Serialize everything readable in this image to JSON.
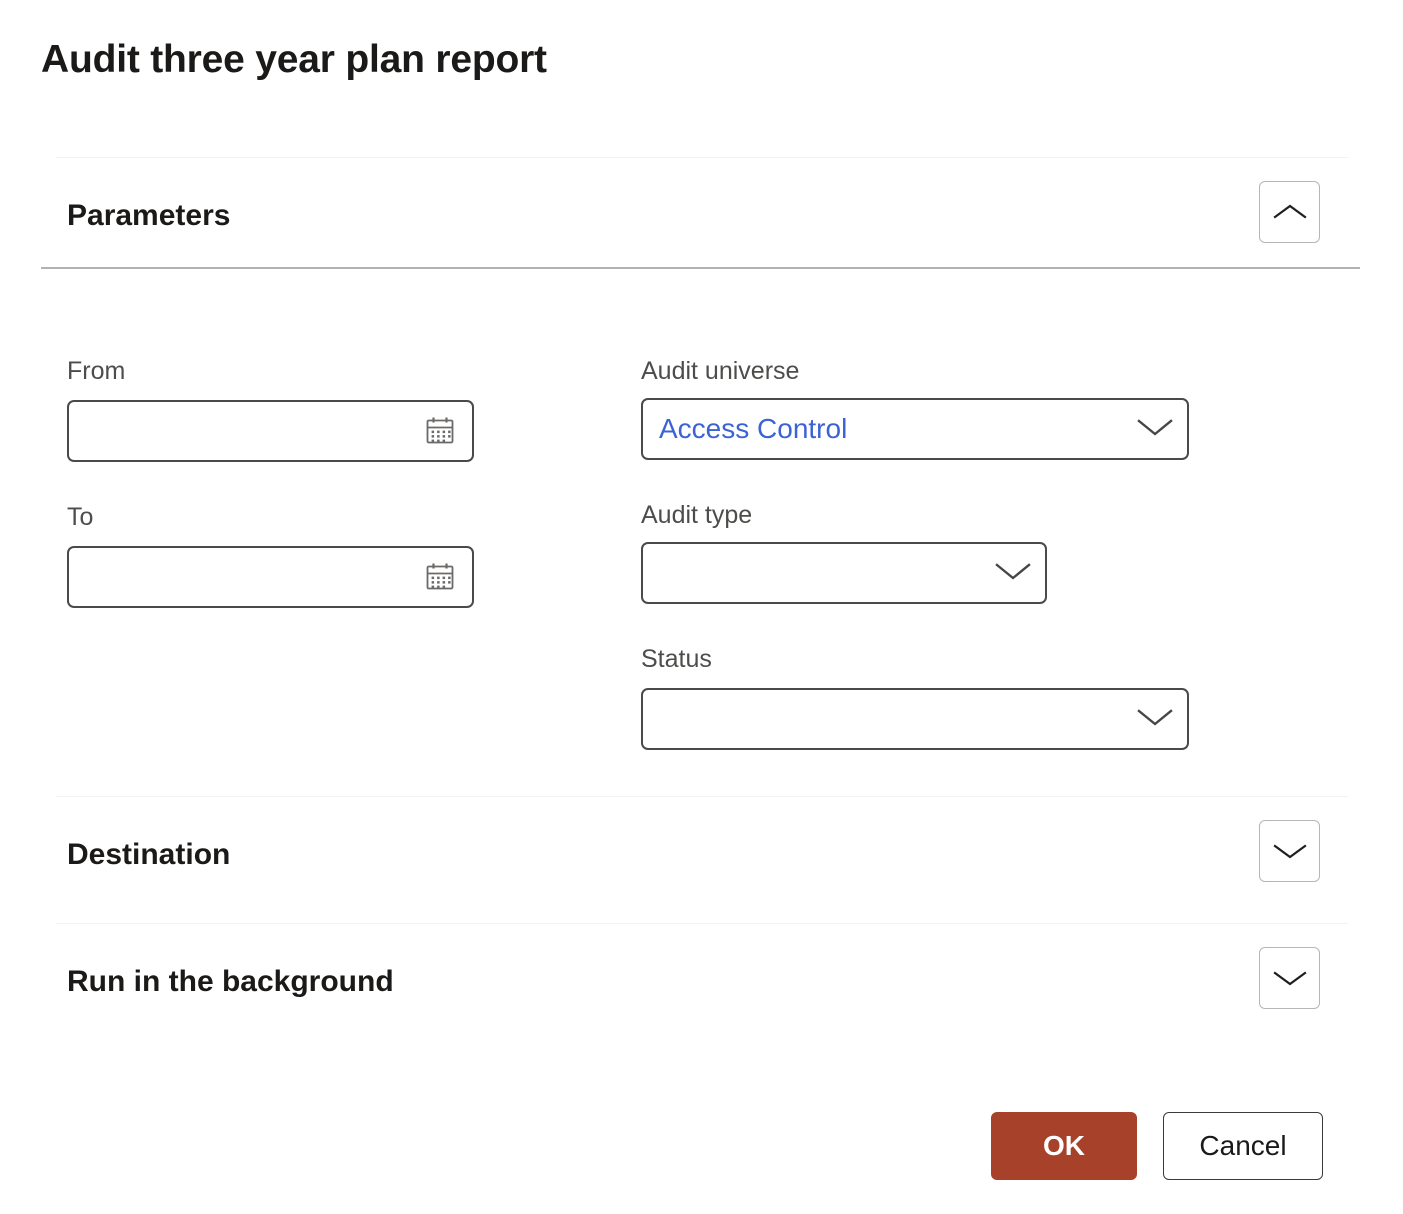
{
  "dialog": {
    "title": "Audit three year plan report"
  },
  "sections": {
    "parameters": {
      "title": "Parameters",
      "toggle_icon": "chevron-up-icon",
      "expanded": true
    },
    "destination": {
      "title": "Destination",
      "toggle_icon": "chevron-down-icon",
      "expanded": false
    },
    "run_in_background": {
      "title": "Run in the background",
      "toggle_icon": "chevron-down-icon",
      "expanded": false
    }
  },
  "fields": {
    "from": {
      "label": "From",
      "value": "",
      "placeholder": "",
      "icon": "calendar-icon"
    },
    "to": {
      "label": "To",
      "value": "",
      "placeholder": "",
      "icon": "calendar-icon"
    },
    "audit_universe": {
      "label": "Audit universe",
      "value": "Access Control",
      "placeholder": "",
      "icon": "chevron-down-icon"
    },
    "audit_type": {
      "label": "Audit type",
      "value": "",
      "placeholder": "",
      "icon": "chevron-down-icon"
    },
    "status": {
      "label": "Status",
      "value": "",
      "placeholder": "",
      "icon": "chevron-down-icon"
    }
  },
  "footer": {
    "ok_label": "OK",
    "cancel_label": "Cancel"
  },
  "colors": {
    "primary_button": "#a8412a",
    "selected_value_text": "#3b63d4",
    "field_border": "#4b4a49",
    "label_text": "#4e4d4b",
    "divider_strong": "#b3b2b1",
    "divider_light": "#f2f2f2"
  }
}
